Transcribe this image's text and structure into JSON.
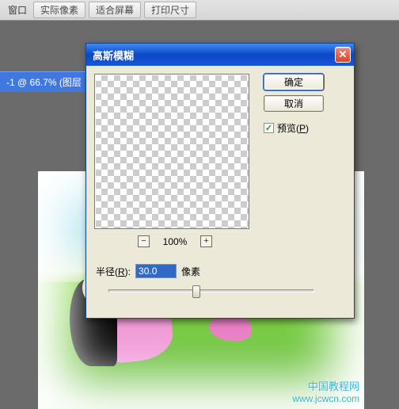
{
  "topbar": {
    "menu_window": "窗口",
    "btn_actual": "实际像素",
    "btn_fit": "适合屏幕",
    "btn_print": "打印尺寸"
  },
  "doc_label": "-1 @ 66.7% (图层",
  "dialog": {
    "title": "高斯模糊",
    "ok": "确定",
    "cancel": "取消",
    "preview_label_pre": "预览(",
    "preview_label_u": "P",
    "preview_label_post": ")",
    "preview_checked": true,
    "zoom_value": "100%",
    "radius_label_pre": "半径(",
    "radius_label_u": "R",
    "radius_label_post": "):",
    "radius_value": "30.0",
    "radius_unit": "像素",
    "minus": "−",
    "plus": "+"
  },
  "watermark": {
    "line1": "中国教程网",
    "line2": "www.jcwcn.com"
  }
}
